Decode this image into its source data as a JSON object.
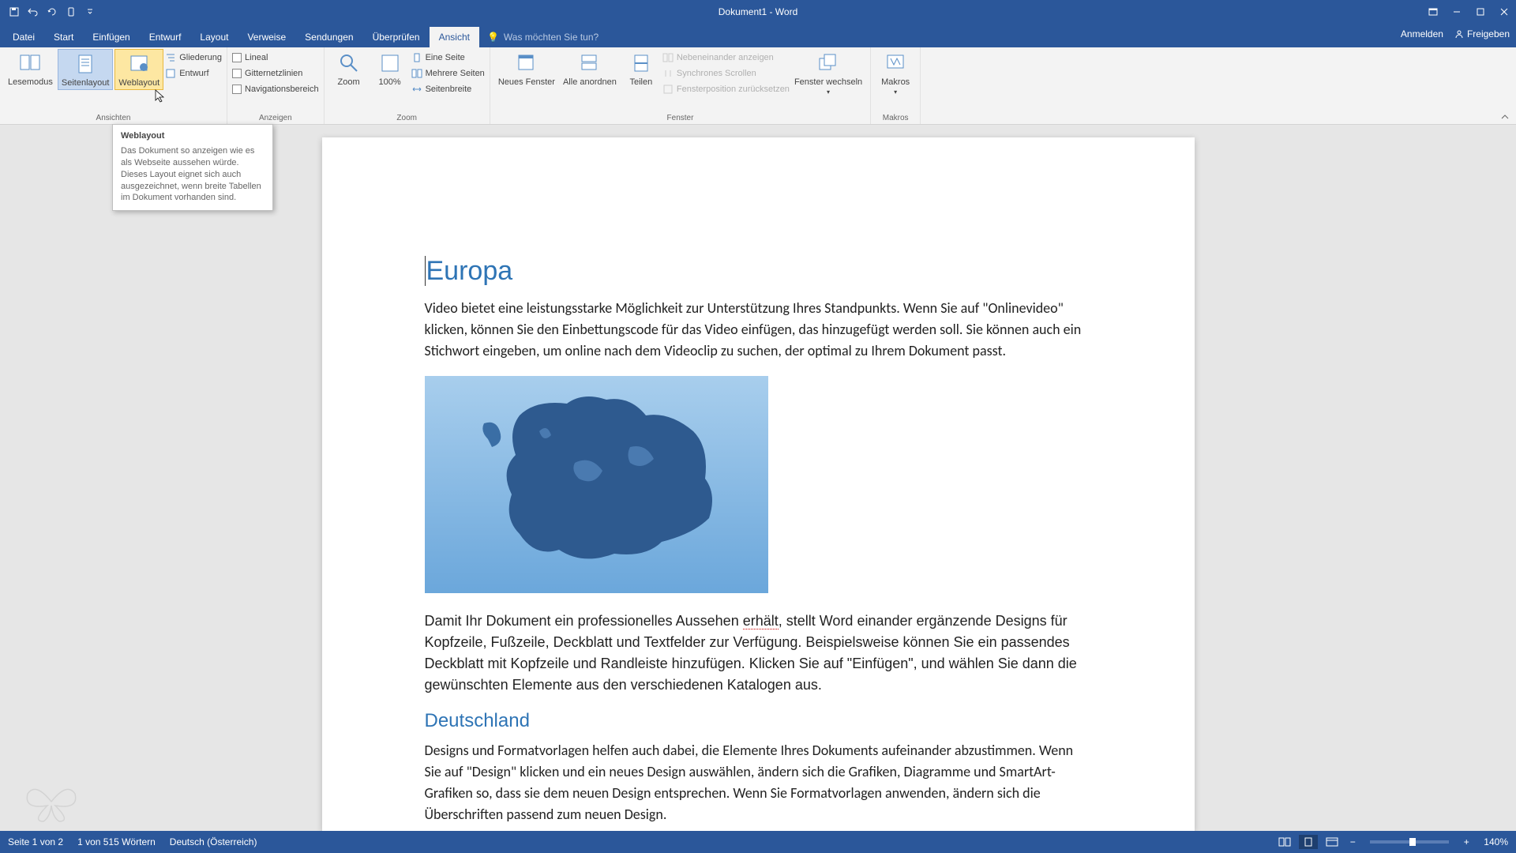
{
  "window": {
    "title": "Dokument1 - Word"
  },
  "qat": {
    "save": "💾",
    "undo": "↶",
    "redo": "↻",
    "touch": "☝"
  },
  "tabs": {
    "datei": "Datei",
    "start": "Start",
    "einfuegen": "Einfügen",
    "entwurf": "Entwurf",
    "layout": "Layout",
    "verweise": "Verweise",
    "sendungen": "Sendungen",
    "ueberpruefen": "Überprüfen",
    "ansicht": "Ansicht",
    "tellme_placeholder": "Was möchten Sie tun?",
    "anmelden": "Anmelden",
    "freigeben": "Freigeben"
  },
  "ribbon": {
    "ansichten": {
      "label": "Ansichten",
      "lesemodus": "Lesemodus",
      "seitenlayout": "Seitenlayout",
      "weblayout": "Weblayout",
      "gliederung": "Gliederung",
      "entwurf": "Entwurf"
    },
    "anzeigen": {
      "label": "Anzeigen",
      "lineal": "Lineal",
      "gitter": "Gitternetzlinien",
      "nav": "Navigationsbereich"
    },
    "zoom": {
      "label": "Zoom",
      "zoom": "Zoom",
      "hundred": "100%",
      "eine_seite": "Eine Seite",
      "mehrere": "Mehrere Seiten",
      "breite": "Seitenbreite"
    },
    "fenster": {
      "label": "Fenster",
      "neues": "Neues Fenster",
      "alle": "Alle anordnen",
      "teilen": "Teilen",
      "nebeneinander": "Nebeneinander anzeigen",
      "synchron": "Synchrones Scrollen",
      "position": "Fensterposition zurücksetzen",
      "wechseln": "Fenster wechseln"
    },
    "makros": {
      "label": "Makros",
      "makros": "Makros"
    }
  },
  "tooltip": {
    "title": "Weblayout",
    "body": "Das Dokument so anzeigen wie es als Webseite aussehen würde. Dieses Layout eignet sich auch ausgezeichnet, wenn breite Tabellen im Dokument vorhanden sind."
  },
  "document": {
    "h1": "Europa",
    "p1": "Video bietet eine leistungsstarke Möglichkeit zur Unterstützung Ihres Standpunkts. Wenn Sie auf \"Onlinevideo\" klicken, können Sie den Einbettungscode für das Video einfügen, das hinzugefügt werden soll. Sie können auch ein Stichwort eingeben, um online nach dem Videoclip zu suchen, der optimal zu Ihrem Dokument passt.",
    "p2a": "Damit Ihr Dokument ein professionelles Aussehen ",
    "p2_err": "erhält",
    "p2b": ", stellt Word einander ergänzende Designs für Kopfzeile, Fußzeile, Deckblatt und Textfelder zur Verfügung. Beispielsweise können Sie ein passendes Deckblatt mit Kopfzeile und Randleiste hinzufügen. Klicken Sie auf \"Einfügen\", und wählen Sie dann die gewünschten Elemente aus den verschiedenen Katalogen aus.",
    "h2": "Deutschland",
    "p3": "Designs und Formatvorlagen helfen auch dabei, die Elemente Ihres Dokuments aufeinander abzustimmen. Wenn Sie auf \"Design\" klicken und ein neues Design auswählen, ändern sich die Grafiken, Diagramme und SmartArt-Grafiken so, dass sie dem neuen Design entsprechen. Wenn Sie Formatvorlagen anwenden, ändern sich die Überschriften passend zum neuen Design."
  },
  "status": {
    "page": "Seite 1 von 2",
    "words": "1 von 515 Wörtern",
    "lang": "Deutsch (Österreich)",
    "zoom_value": "140%"
  }
}
